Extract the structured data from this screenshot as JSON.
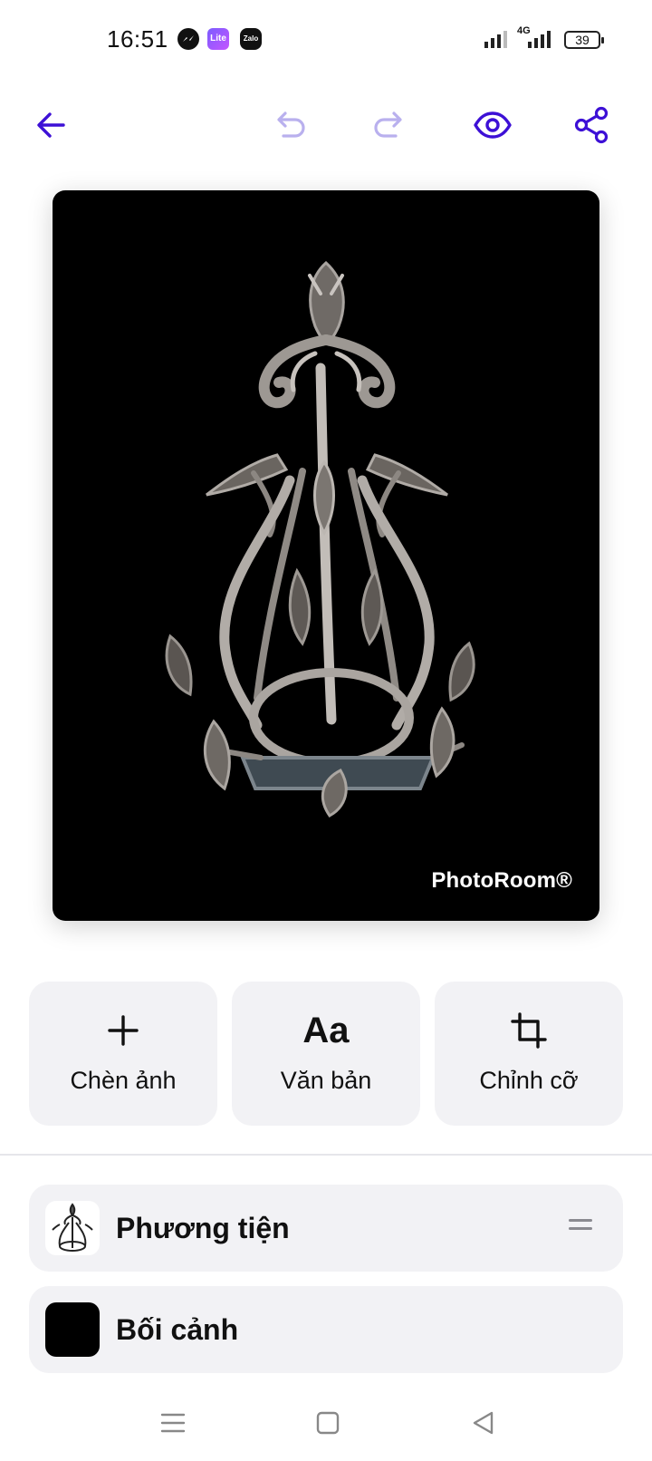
{
  "status_bar": {
    "time": "16:51",
    "notifications": [
      "messenger-icon",
      "lite-icon",
      "zalo-icon"
    ],
    "lite_label": "Lite",
    "zalo_label": "Zalo",
    "network_label": "4G",
    "battery_level": "39"
  },
  "toolbar": {
    "icons": [
      "back-arrow-icon",
      "undo-icon",
      "redo-icon",
      "eye-icon",
      "share-icon"
    ],
    "accent_color": "#3d10d6",
    "disabled_color": "#b9b0ee"
  },
  "canvas": {
    "background_color": "#000000",
    "watermark": "PhotoRoom®"
  },
  "actions": [
    {
      "icon": "plus-icon",
      "label": "Chèn ảnh"
    },
    {
      "icon": "text-aa-icon",
      "glyph": "Aa",
      "label": "Văn bản"
    },
    {
      "icon": "crop-icon",
      "label": "Chỉnh cỡ"
    }
  ],
  "layers": [
    {
      "label": "Phương tiện",
      "thumb": "product-thumbnail"
    },
    {
      "label": "Bối cảnh",
      "thumb_color": "#000000"
    }
  ],
  "nav_bar": {
    "icons": [
      "menu-icon",
      "home-square-icon",
      "back-triangle-icon"
    ]
  }
}
